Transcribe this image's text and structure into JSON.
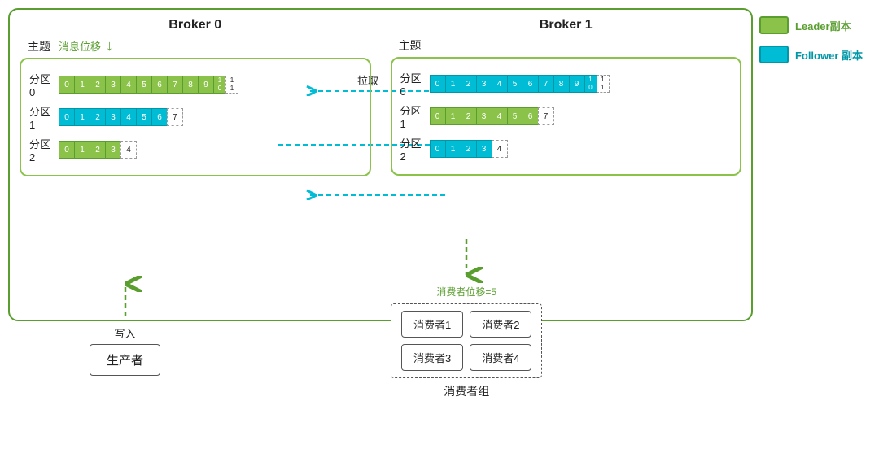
{
  "legend": {
    "leader_label": "Leader副本",
    "follower_label": "Follower 副本",
    "leader_color": "#8BC34A",
    "follower_color": "#00BCD4"
  },
  "broker0": {
    "title": "Broker 0",
    "topic_label": "主题",
    "offset_label": "消息位移",
    "partitions": [
      {
        "name": "分区0",
        "cells": [
          "0",
          "1",
          "2",
          "3",
          "4",
          "5",
          "6",
          "7",
          "8",
          "9",
          "1\n0",
          "1\n1"
        ],
        "type": "green",
        "dashed_count": 2
      },
      {
        "name": "分区1",
        "cells": [
          "0",
          "1",
          "2",
          "3",
          "4",
          "5",
          "6",
          "7"
        ],
        "type": "blue",
        "dashed_count": 1
      },
      {
        "name": "分区2",
        "cells": [
          "0",
          "1",
          "2",
          "3",
          "4"
        ],
        "type": "green",
        "dashed_count": 1
      }
    ]
  },
  "broker1": {
    "title": "Broker 1",
    "topic_label": "主题",
    "partitions": [
      {
        "name": "分区0",
        "cells": [
          "0",
          "1",
          "2",
          "3",
          "4",
          "5",
          "6",
          "7",
          "8",
          "9",
          "1\n0",
          "1\n1"
        ],
        "type": "blue",
        "dashed_count": 2
      },
      {
        "name": "分区1",
        "cells": [
          "0",
          "1",
          "2",
          "3",
          "4",
          "5",
          "6",
          "7"
        ],
        "type": "green",
        "dashed_count": 1
      },
      {
        "name": "分区2",
        "cells": [
          "0",
          "1",
          "2",
          "3",
          "4"
        ],
        "type": "blue",
        "dashed_count": 1
      }
    ]
  },
  "arrows": [
    {
      "label": "拉取",
      "direction": "left",
      "row": 0
    },
    {
      "label": "",
      "direction": "right",
      "row": 1
    },
    {
      "label": "",
      "direction": "left",
      "row": 2
    }
  ],
  "producer": {
    "write_label": "写入",
    "box_label": "生产者"
  },
  "consumer_group": {
    "offset_label": "消费者位移=5",
    "consumers": [
      "消费者1",
      "消费者2",
      "消费者3",
      "消费者4"
    ],
    "group_label": "消费者组"
  }
}
